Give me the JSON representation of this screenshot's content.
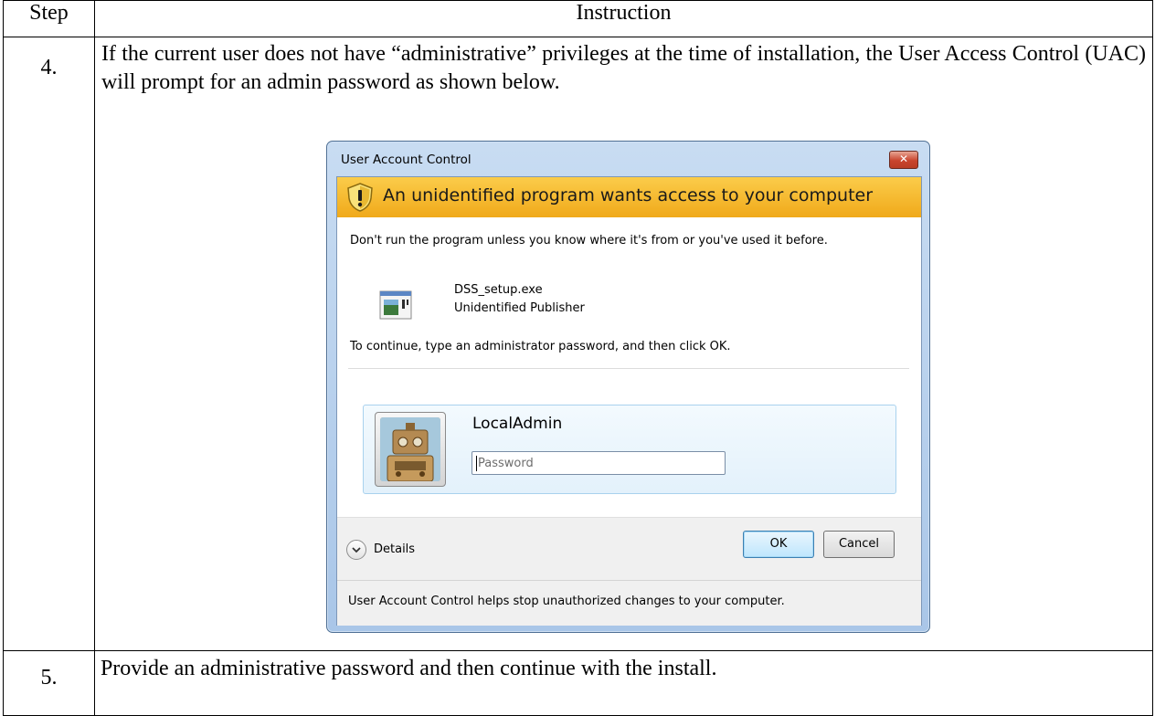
{
  "table": {
    "header_step": "Step",
    "header_instruction": "Instruction",
    "rows": [
      {
        "step": "4.",
        "text": "If the current user does not have “administrative” privileges at the time of installation, the User Access Control (UAC) will prompt for an admin password as shown below."
      },
      {
        "step": "5.",
        "text": "Provide an administrative password and then continue with the install."
      }
    ]
  },
  "dialog": {
    "title": "User Account Control",
    "close_icon": "close-x",
    "banner_text": "An unidentified program wants access to your computer",
    "banner_icon": "warning-shield-icon",
    "message": "Don't run the program unless you know where it's from or you've used it before.",
    "program_name": "DSS_setup.exe",
    "publisher": "Unidentified Publisher",
    "instruction": "To continue, type an administrator password, and then click OK.",
    "username": "LocalAdmin",
    "password_placeholder": "Password",
    "details_label": "Details",
    "ok_label": "OK",
    "cancel_label": "Cancel",
    "footer_text": "User Account Control helps stop unauthorized changes to your computer."
  }
}
